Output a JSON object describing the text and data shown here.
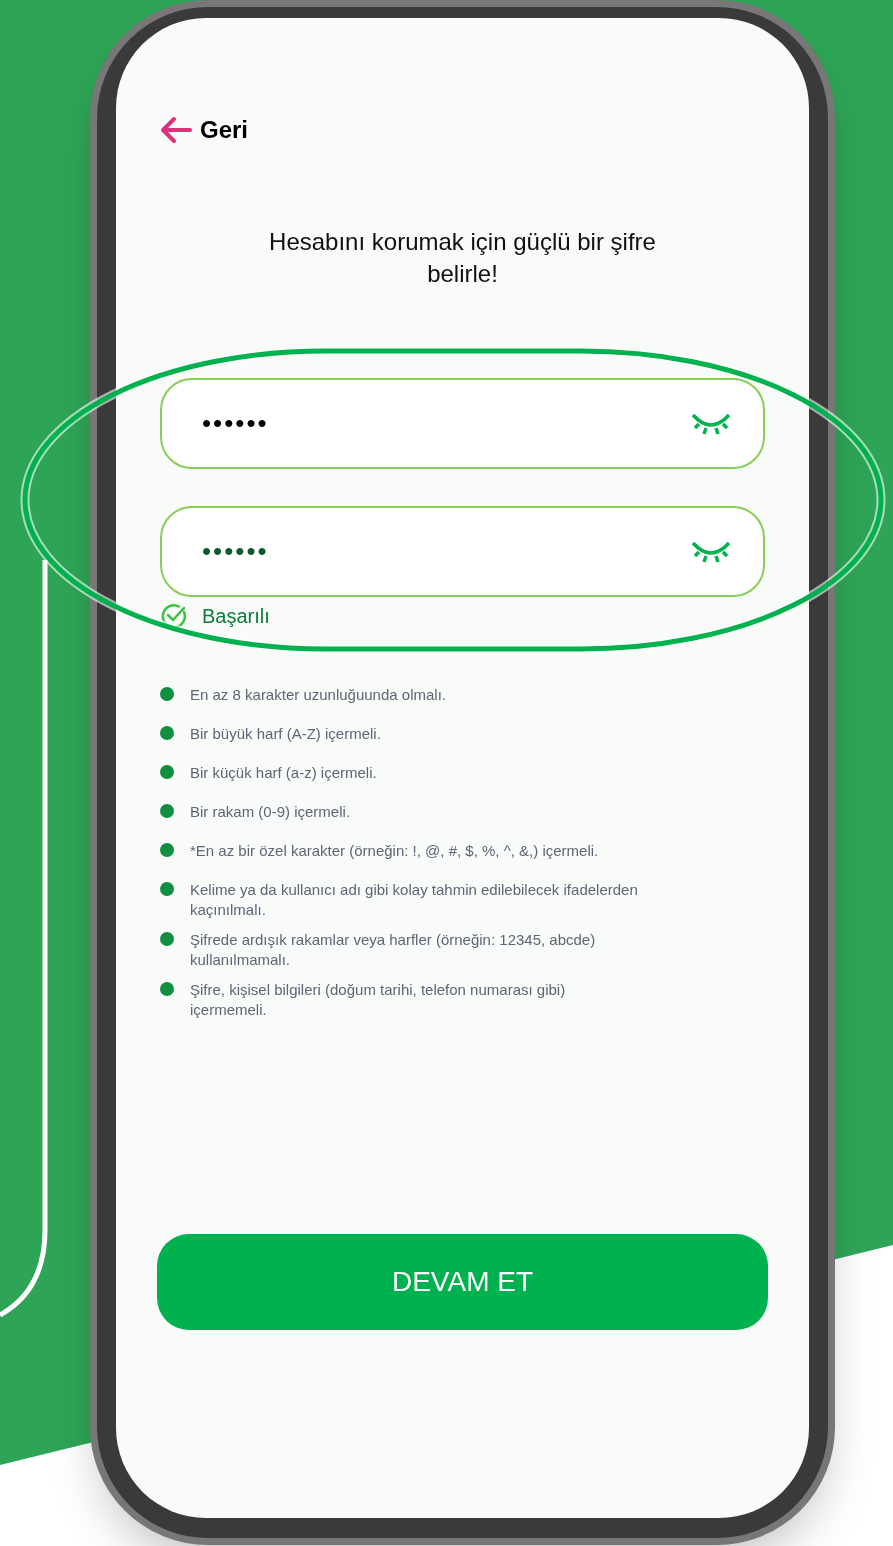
{
  "back": {
    "label": "Geri"
  },
  "title": "Hesabını korumak için güçlü bir şifre belirle!",
  "fields": [
    {
      "value": "••••••",
      "matched": false
    },
    {
      "value": "••••••",
      "matched": true
    }
  ],
  "status": {
    "kind": "success",
    "text": "Başarılı"
  },
  "rules": [
    {
      "text": "En az 8 karakter uzunluğuunda olmalı."
    },
    {
      "text": "Bir büyük harf (A-Z) içermeli."
    },
    {
      "text": "Bir küçük harf (a-z) içermeli."
    },
    {
      "text": "Bir rakam (0-9) içermeli."
    },
    {
      "text": "*En az bir özel karakter (örneğin: !, @, #, $, %, ^, &,) içermeli."
    },
    {
      "text": "Kelime ya da kullanıcı adı gibi kolay tahmin edilebilecek ifadelerden kaçınılmalı."
    },
    {
      "text": "Şifrede ardışık rakamlar veya harfler (örneğin: 12345, abcde) kullanılmamalı."
    },
    {
      "text": "Şifre, kişisel bilgileri (doğum tarihi, telefon numarası gibi) içermemeli."
    }
  ],
  "button": {
    "label": "DEVAM ET"
  }
}
